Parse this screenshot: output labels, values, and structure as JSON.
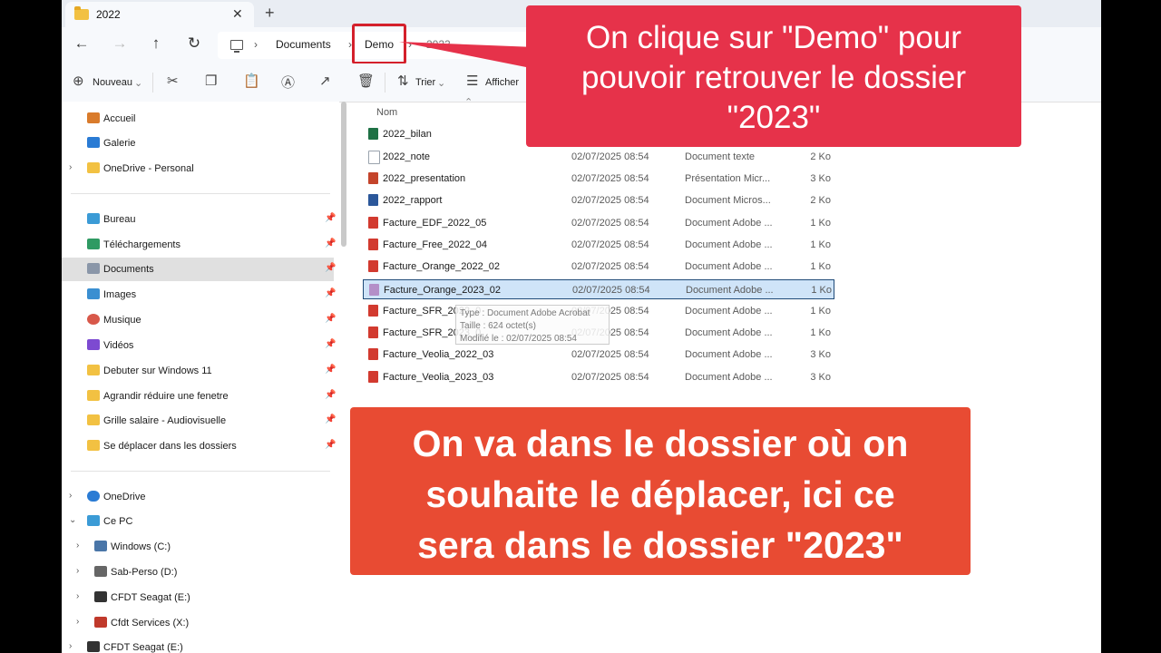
{
  "tab": {
    "title": "2022",
    "close": "✕",
    "new": "+"
  },
  "nav": {
    "back": "←",
    "forward": "→",
    "up": "↑",
    "refresh": "↻"
  },
  "breadcrumb": {
    "items": [
      "Documents",
      "Demo",
      "2022"
    ],
    "sep": "›"
  },
  "toolbar": {
    "new_label": "Nouveau",
    "sort_label": "Trier",
    "view_label": "Afficher"
  },
  "sidebar": {
    "items": [
      {
        "label": "Accueil",
        "icon": "home-icon",
        "color": "#d97b2b"
      },
      {
        "label": "Galerie",
        "icon": "gallery-icon",
        "color": "#2a7bd4"
      },
      {
        "label": "OneDrive - Personal",
        "icon": "folder-icon",
        "color": "#f2c142"
      },
      {
        "label": "Bureau",
        "icon": "desktop-icon",
        "color": "#3b9bd6"
      },
      {
        "label": "Téléchargements",
        "icon": "download-icon",
        "color": "#2f9a63"
      },
      {
        "label": "Documents",
        "icon": "documents-icon",
        "color": "#8a96a8"
      },
      {
        "label": "Images",
        "icon": "images-icon",
        "color": "#3a8fd1"
      },
      {
        "label": "Musique",
        "icon": "music-icon",
        "color": "#d8584a"
      },
      {
        "label": "Vidéos",
        "icon": "video-icon",
        "color": "#7d4ad1"
      },
      {
        "label": "Debuter sur Windows 11",
        "icon": "folder-icon",
        "color": "#f2c142"
      },
      {
        "label": "Agrandir réduire une fenetre",
        "icon": "folder-icon",
        "color": "#f2c142"
      },
      {
        "label": "Grille salaire - Audiovisuelle",
        "icon": "folder-icon",
        "color": "#f2c142"
      },
      {
        "label": "Se déplacer dans les dossiers",
        "icon": "folder-icon",
        "color": "#f2c142"
      },
      {
        "label": "OneDrive",
        "icon": "cloud-icon",
        "color": "#2a7bd4"
      },
      {
        "label": "Ce PC",
        "icon": "pc-icon",
        "color": "#3b9bd6"
      },
      {
        "label": "Windows (C:)",
        "icon": "drive-icon",
        "color": "#4a76a8"
      },
      {
        "label": "Sab-Perso (D:)",
        "icon": "drive-icon",
        "color": "#666666"
      },
      {
        "label": "CFDT Seagat (E:)",
        "icon": "drive-icon",
        "color": "#333333"
      },
      {
        "label": "Cfdt Services (X:)",
        "icon": "network-drive-icon",
        "color": "#c0392b"
      },
      {
        "label": "CFDT Seagat (E:)",
        "icon": "drive-icon",
        "color": "#333333"
      }
    ]
  },
  "columns": {
    "name": "Nom"
  },
  "files": [
    {
      "name": "2022_bilan",
      "date": "",
      "type": "",
      "size": "",
      "color": "#1e7145"
    },
    {
      "name": "2022_note",
      "date": "02/07/2025 08:54",
      "type": "Document texte",
      "size": "2 Ko",
      "color": "#9aa3ad"
    },
    {
      "name": "2022_presentation",
      "date": "02/07/2025 08:54",
      "type": "Présentation Micr...",
      "size": "3 Ko",
      "color": "#c4442b"
    },
    {
      "name": "2022_rapport",
      "date": "02/07/2025 08:54",
      "type": "Document Micros...",
      "size": "2 Ko",
      "color": "#2b579a"
    },
    {
      "name": "Facture_EDF_2022_05",
      "date": "02/07/2025 08:54",
      "type": "Document Adobe ...",
      "size": "1 Ko",
      "color": "#d23a2f"
    },
    {
      "name": "Facture_Free_2022_04",
      "date": "02/07/2025 08:54",
      "type": "Document Adobe ...",
      "size": "1 Ko",
      "color": "#d23a2f"
    },
    {
      "name": "Facture_Orange_2022_02",
      "date": "02/07/2025 08:54",
      "type": "Document Adobe ...",
      "size": "1 Ko",
      "color": "#d23a2f"
    },
    {
      "name": "Facture_Orange_2023_02",
      "date": "02/07/2025 08:54",
      "type": "Document Adobe ...",
      "size": "1 Ko",
      "color": "#b48fc8"
    },
    {
      "name": "Facture_SFR_2022_0",
      "date": "02/07/2025 08:54",
      "type": "Document Adobe ...",
      "size": "1 Ko",
      "color": "#d23a2f"
    },
    {
      "name": "Facture_SFR_2023_0",
      "date": "02/07/2025 08:54",
      "type": "Document Adobe ...",
      "size": "1 Ko",
      "color": "#d23a2f"
    },
    {
      "name": "Facture_Veolia_2022_03",
      "date": "02/07/2025 08:54",
      "type": "Document Adobe ...",
      "size": "3 Ko",
      "color": "#d23a2f"
    },
    {
      "name": "Facture_Veolia_2023_03",
      "date": "02/07/2025 08:54",
      "type": "Document Adobe ...",
      "size": "3 Ko",
      "color": "#d23a2f"
    }
  ],
  "tooltip": {
    "line1": "Type : Document Adobe Acrobat",
    "line2": "Taille : 624 octet(s)",
    "line3": "Modifié le : 02/07/2025 08:54"
  },
  "callouts": {
    "top": [
      "On clique sur \"Demo\" pour",
      "pouvoir retrouver le dossier",
      "\"2023\""
    ],
    "bottom": [
      "On va dans le dossier où on",
      "souhaite le déplacer, ici ce",
      "sera dans le dossier \"2023\""
    ]
  }
}
